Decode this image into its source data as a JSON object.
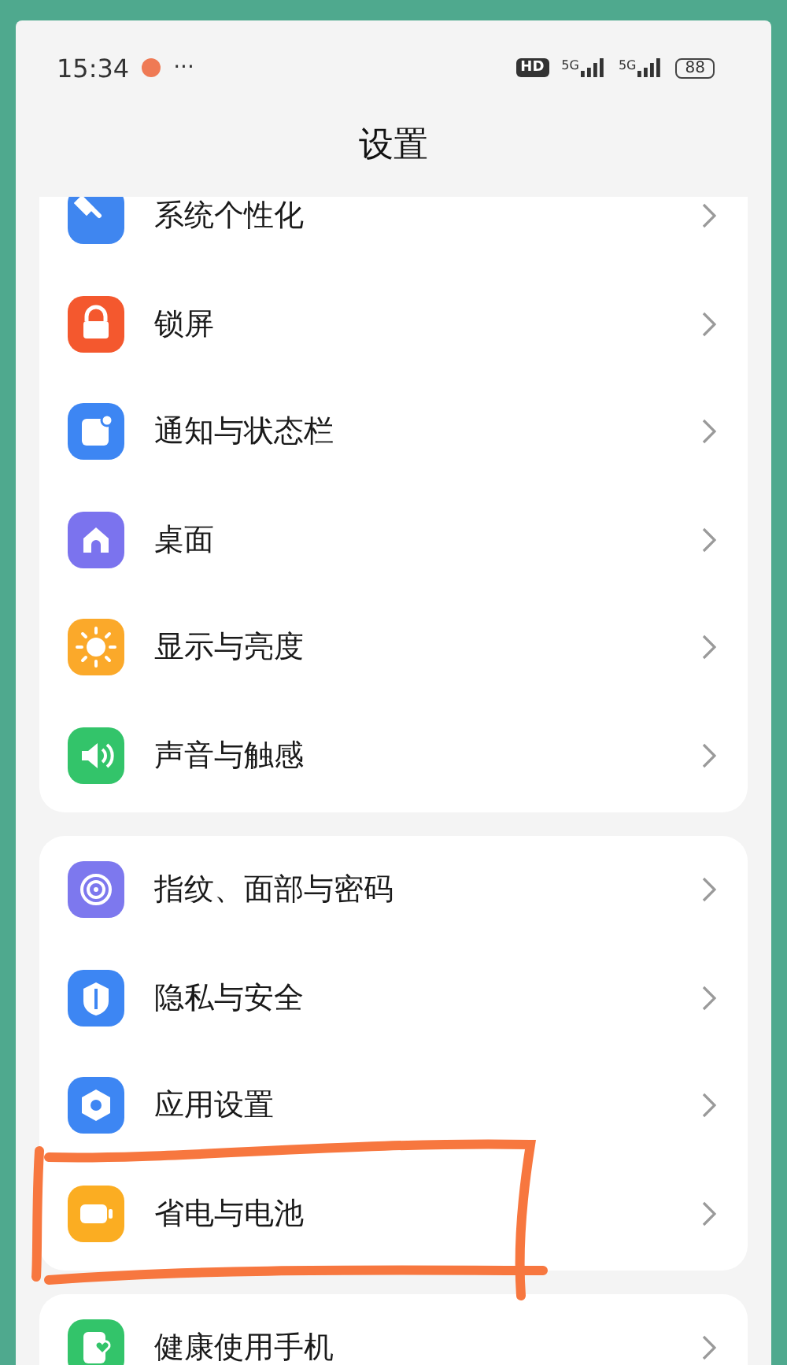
{
  "status_bar": {
    "time": "15:34",
    "more": "···",
    "hd_label": "HD",
    "sim_labels": [
      "5G",
      "5G"
    ],
    "battery": "88"
  },
  "title": "设置",
  "groups": [
    {
      "items": [
        {
          "label": "系统个性化",
          "kind": "brush",
          "color": "#3f86f0",
          "circled": false
        },
        {
          "label": "锁屏",
          "kind": "lock",
          "color": "#f4582e",
          "circled": false
        },
        {
          "label": "通知与状态栏",
          "kind": "notify",
          "color": "#3d86f3",
          "circled": false
        },
        {
          "label": "桌面",
          "kind": "home",
          "color": "#7b73ee",
          "circled": false
        },
        {
          "label": "显示与亮度",
          "kind": "sun",
          "color": "#fba92a",
          "circled": false
        },
        {
          "label": "声音与触感",
          "kind": "sound",
          "color": "#33c46a",
          "circled": false
        }
      ]
    },
    {
      "items": [
        {
          "label": "指纹、面部与密码",
          "kind": "finger",
          "color": "#7d78ee",
          "circled": false
        },
        {
          "label": "隐私与安全",
          "kind": "shield",
          "color": "#3d86f3",
          "circled": false
        },
        {
          "label": "应用设置",
          "kind": "hex",
          "color": "#3d86f3",
          "circled": false
        },
        {
          "label": "省电与电池",
          "kind": "battery",
          "color": "#fbad22",
          "circled": true
        }
      ]
    },
    {
      "items": [
        {
          "label": "健康使用手机",
          "kind": "health",
          "color": "#33c46a",
          "circled": false
        }
      ]
    }
  ]
}
